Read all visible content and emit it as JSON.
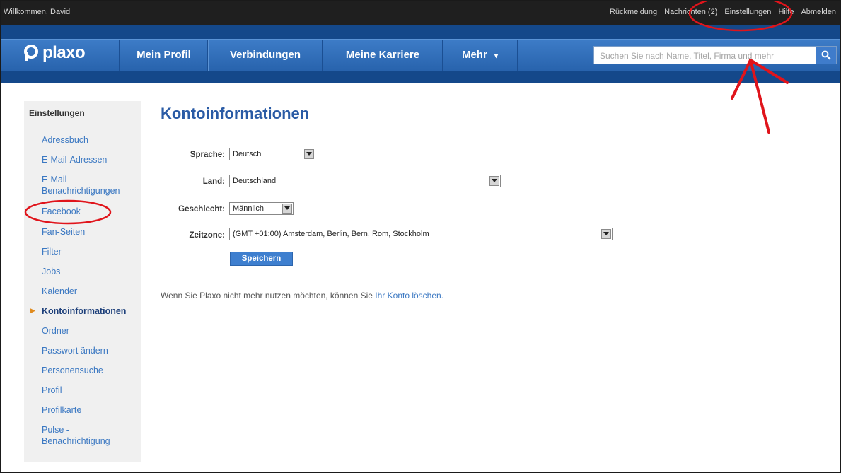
{
  "topbar": {
    "welcome": "Willkommen, David",
    "links": [
      "Rückmeldung",
      "Nachrichten (2)",
      "Einstellungen",
      "Hilfe",
      "Abmelden"
    ]
  },
  "nav": {
    "logo": "plaxo",
    "items": [
      "Mein Profil",
      "Verbindungen",
      "Meine Karriere",
      "Mehr"
    ],
    "search_placeholder": "Suchen Sie nach Name, Titel, Firma und mehr"
  },
  "sidebar": {
    "title": "Einstellungen",
    "items": [
      "Adressbuch",
      "E-Mail-Adressen",
      "E-Mail-",
      "Benachrichtigungen",
      "Facebook",
      "Fan-Seiten",
      "Filter",
      "Jobs",
      "Kalender",
      "Kontoinformationen",
      "Ordner",
      "Passwort ändern",
      "Personensuche",
      "Profil",
      "Profilkarte",
      "Pulse -",
      "Benachrichtigung"
    ],
    "active": "Kontoinformationen"
  },
  "main": {
    "title": "Kontoinformationen",
    "fields": {
      "language_label": "Sprache:",
      "language_value": "Deutsch",
      "country_label": "Land:",
      "country_value": "Deutschland",
      "gender_label": "Geschlecht:",
      "gender_value": "Männlich",
      "timezone_label": "Zeitzone:",
      "timezone_value": "(GMT +01:00) Amsterdam, Berlin, Bern, Rom, Stockholm"
    },
    "save_label": "Speichern",
    "delete_text": "Wenn Sie Plaxo nicht mehr nutzen möchten, können Sie ",
    "delete_link": "Ihr Konto löschen."
  },
  "colors": {
    "nav_blue": "#2863ad",
    "link_blue": "#3b78c2",
    "annotation_red": "#e0141b"
  }
}
